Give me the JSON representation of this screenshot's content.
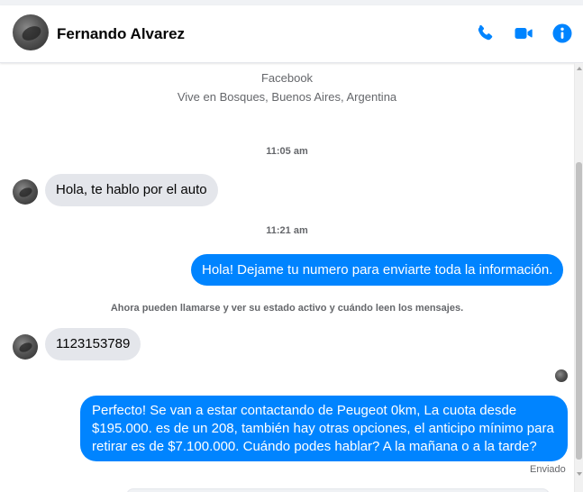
{
  "header": {
    "contact_name": "Fernando Alvarez",
    "icons": [
      "phone-icon",
      "video-camera-icon",
      "info-icon"
    ],
    "accent_color": "#0084ff"
  },
  "profile": {
    "platform": "Facebook",
    "location": "Vive en Bosques, Buenos Aires, Argentina"
  },
  "conversation": {
    "timestamp_1": "11:05 am",
    "message_1": "Hola, te hablo por el auto",
    "timestamp_2": "11:21 am",
    "message_2": "Hola! Dejame tu numero  para enviarte toda la información.",
    "notice": "Ahora pueden llamarse y ver su estado activo y cuándo leen los mensajes.",
    "message_3": "1123153789",
    "message_4": "Perfecto!  Se van a estar contactando de Peugeot 0km, La cuota desde $195.000. es de un 208, también hay otras opciones, el anticipo mínimo para retirar es de $7.100.000. Cuándo podes hablar? A la mañana o a la tarde?",
    "status": "Enviado"
  },
  "colors": {
    "outgoing_bubble": "#0084ff",
    "incoming_bubble": "#e4e6eb",
    "muted_text": "#65676b"
  }
}
